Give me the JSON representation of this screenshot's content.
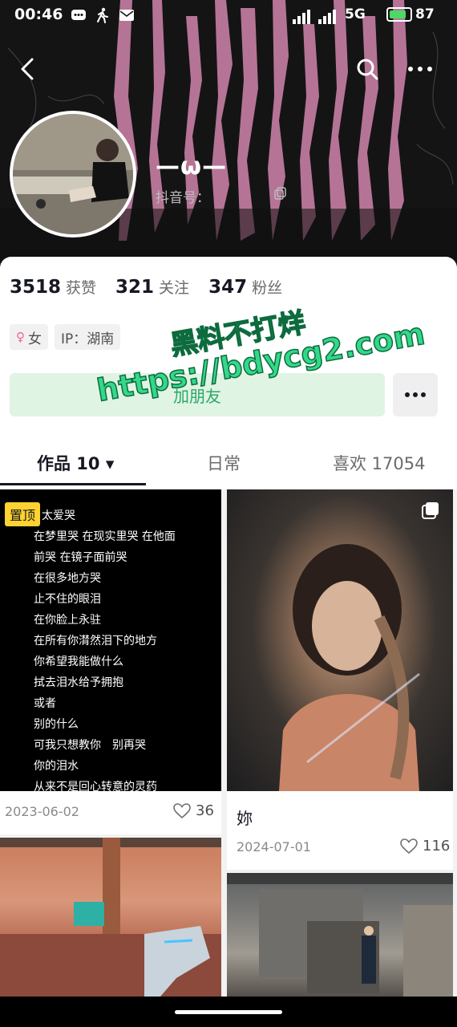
{
  "status_bar": {
    "time": "00:46",
    "network": "5G",
    "battery": "87"
  },
  "profile": {
    "nickname": "—ω—",
    "douyin_id_label": "抖音号："
  },
  "stats": [
    {
      "value": "3518",
      "label": "获赞"
    },
    {
      "value": "321",
      "label": "关注"
    },
    {
      "value": "347",
      "label": "粉丝"
    }
  ],
  "tags": {
    "gender": "女",
    "ip": "IP：湖南"
  },
  "actions": {
    "add_friend": "加朋友"
  },
  "tabs": [
    {
      "label": "作品 10 ▾"
    },
    {
      "label": "日常"
    },
    {
      "label": "喜欢 17054"
    }
  ],
  "watermark": {
    "line1": "黑料不打烊",
    "line2": "https://bdycg2.com"
  },
  "posts": [
    {
      "pinned_label": "置顶",
      "lyrics": [
        "太爱哭",
        "在梦里哭 在现实里哭 在他面",
        "前哭 在镜子面前哭",
        "在很多地方哭",
        "止不住的眼泪",
        "在你脸上永驻",
        "在所有你潸然泪下的地方",
        "你希望我能做什么",
        "拭去泪水给予拥抱",
        "或者",
        "别的什么",
        "可我只想教你　别再哭",
        "你的泪水",
        "从来不是回心转意的灵药"
      ],
      "date": "2023-06-02",
      "likes": "36"
    },
    {
      "caption": "妳",
      "date": "2024-07-01",
      "likes": "116"
    }
  ],
  "colors": {
    "accent_green": "#2ca76a",
    "pin_yellow": "#fed230",
    "gender_pink": "#f2609a"
  }
}
